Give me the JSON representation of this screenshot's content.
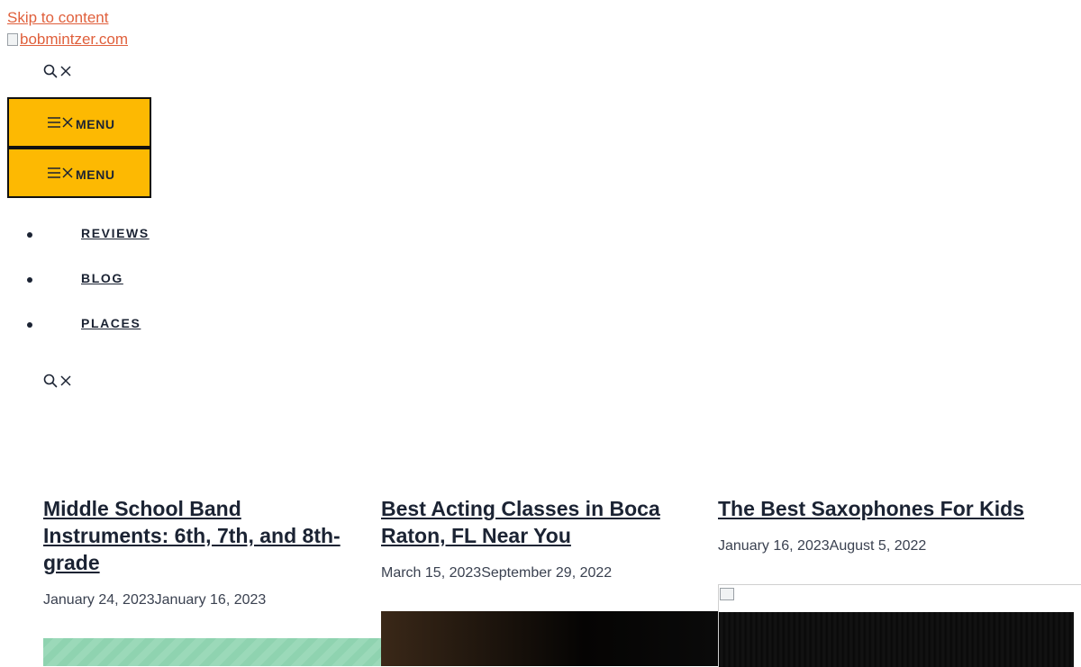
{
  "skip_link": "Skip to content",
  "logo_alt": "bobmintzer.com",
  "menu_button_label": "MENU",
  "nav": {
    "items": [
      {
        "label": "REVIEWS"
      },
      {
        "label": "BLOG"
      },
      {
        "label": "PLACES"
      }
    ]
  },
  "posts": [
    {
      "title": "Middle School Band Instruments: 6th, 7th, and 8th-grade",
      "date_published": "January 24, 2023",
      "date_updated": "January 16, 2023"
    },
    {
      "title": "Best Acting Classes in Boca Raton, FL Near You",
      "date_published": "March 15, 2023",
      "date_updated": "September 29, 2022"
    },
    {
      "title": "The Best Saxophones For Kids",
      "date_published": "January 16, 2023",
      "date_updated": "August 5, 2022"
    }
  ],
  "colors": {
    "link": "#e0603c",
    "menu_button_bg": "#fdb902",
    "text": "#1b2333"
  },
  "icons": {
    "search": "search-icon",
    "close": "close-icon",
    "hamburger": "hamburger-icon"
  }
}
